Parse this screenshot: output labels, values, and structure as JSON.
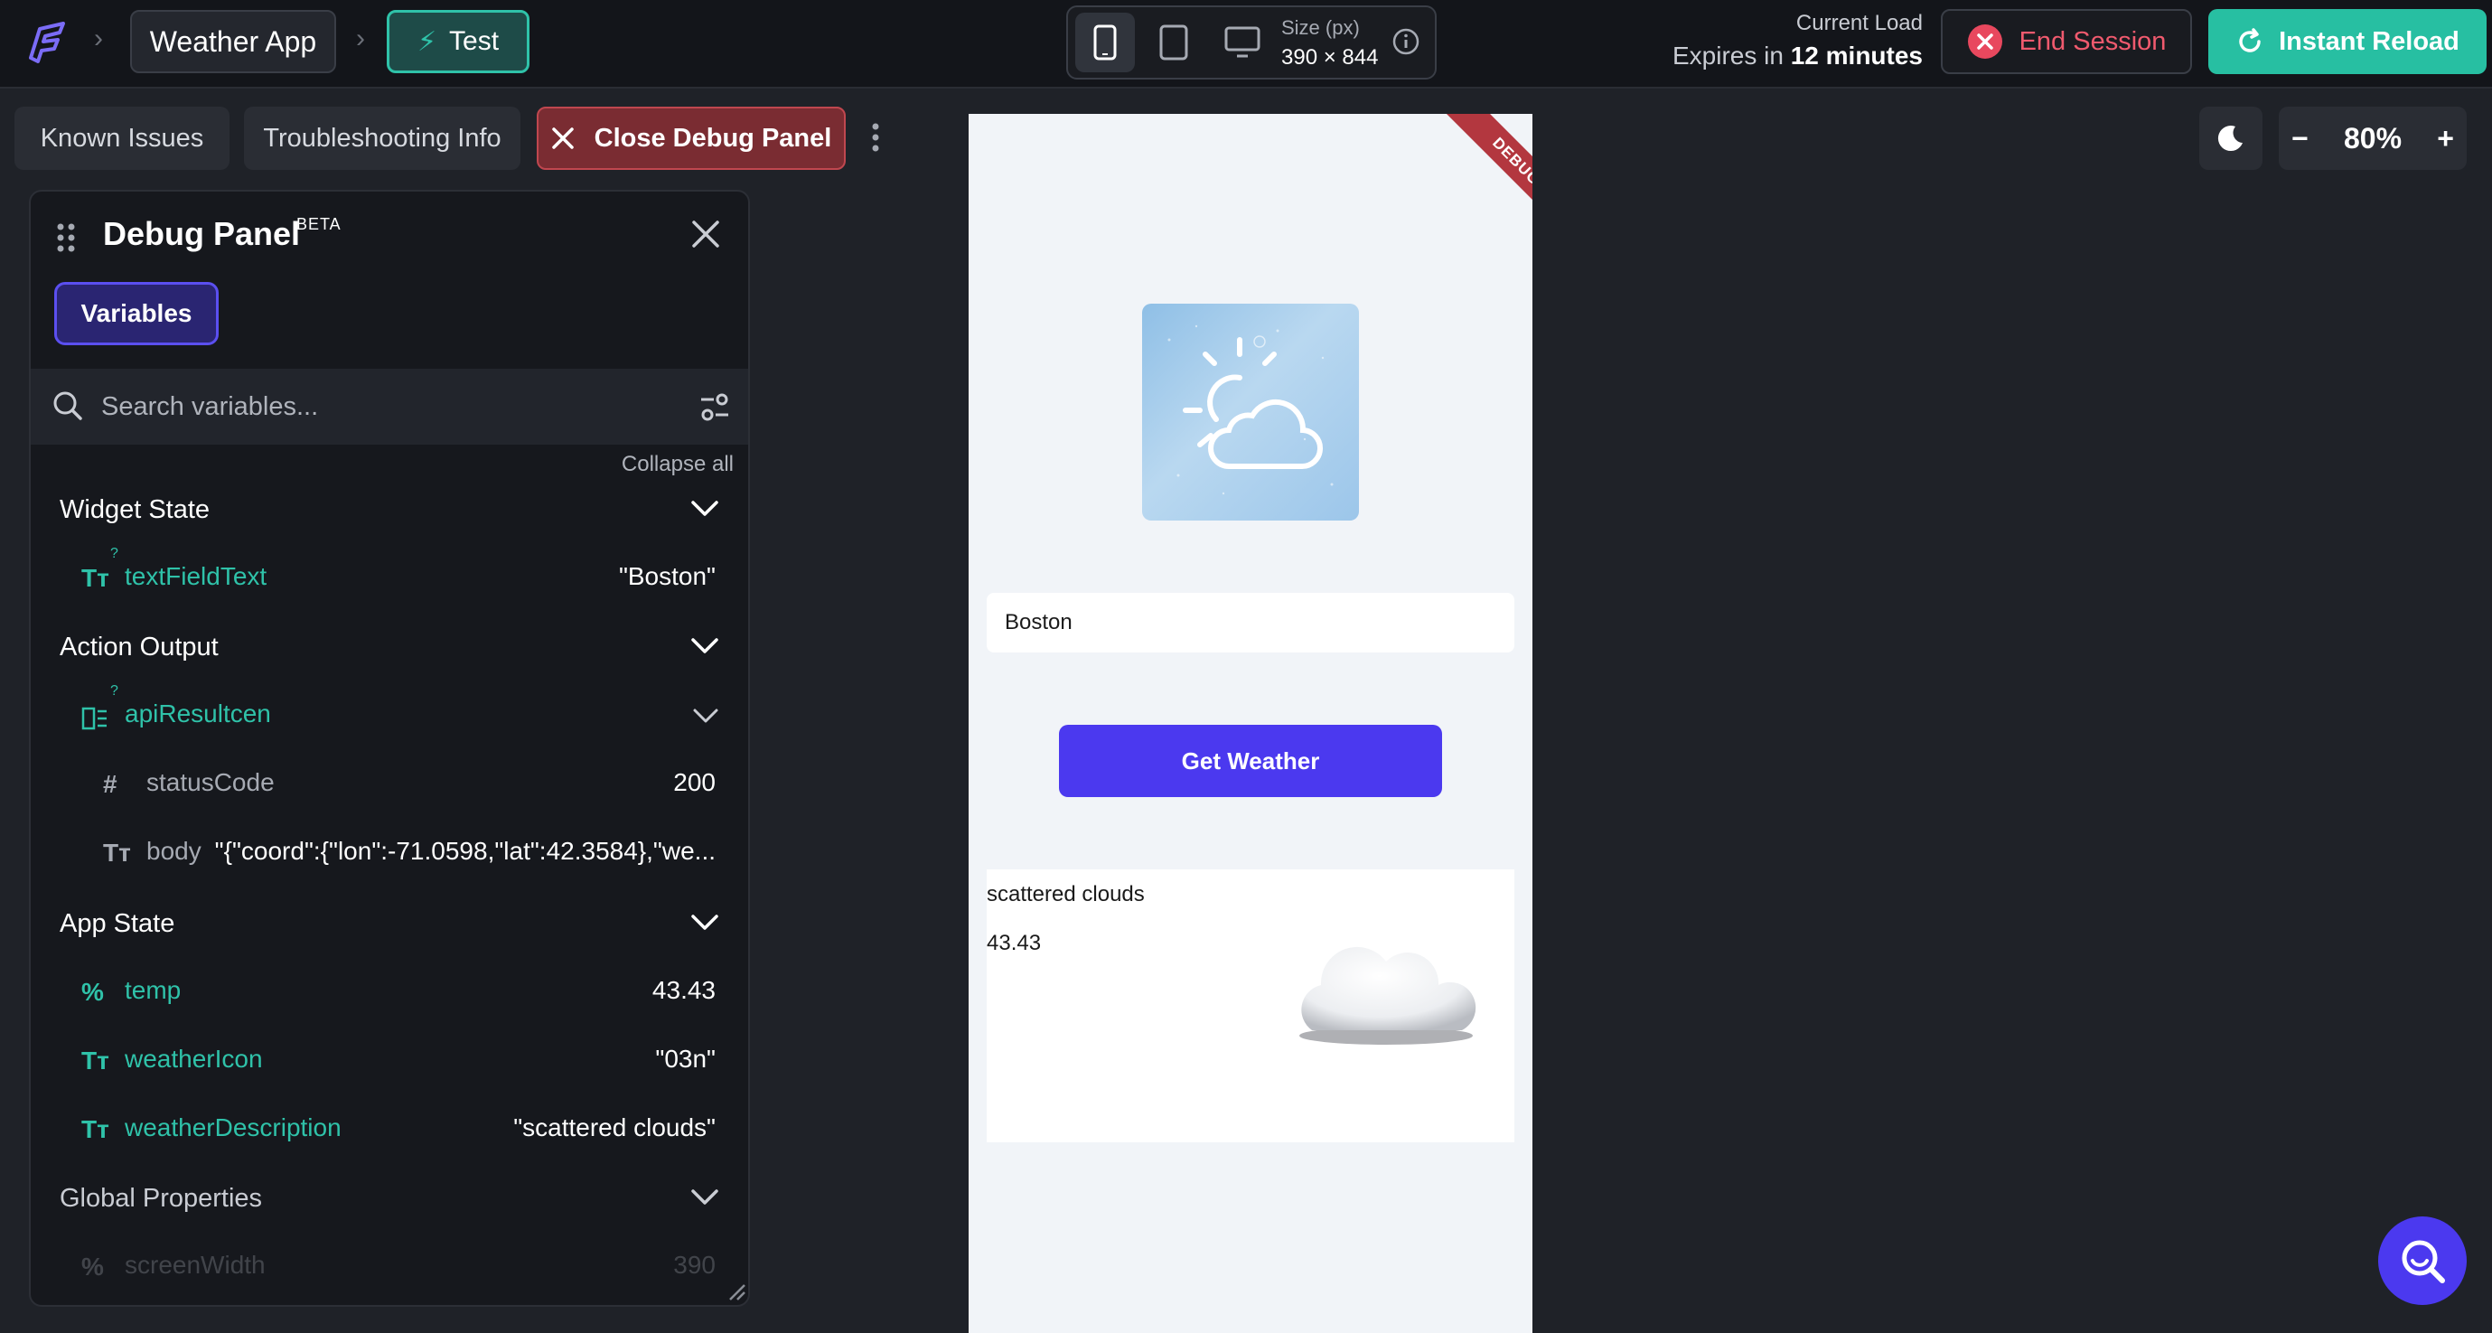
{
  "topbar": {
    "app_name": "Weather App",
    "mode_label": "Test",
    "device_size_label": "Size (px)",
    "device_size_value": "390 × 844",
    "current_load_label": "Current Load",
    "expires_prefix": "Expires in",
    "expires_value": "12 minutes",
    "end_session_label": "End Session",
    "instant_reload_label": "Instant Reload"
  },
  "toolbar": {
    "known_issues_label": "Known Issues",
    "troubleshooting_label": "Troubleshooting Info",
    "close_debug_label": "Close Debug Panel",
    "zoom_minus": "−",
    "zoom_level": "80%",
    "zoom_plus": "+"
  },
  "debug_panel": {
    "title": "Debug Panel",
    "badge": "BETA",
    "tab_variables": "Variables",
    "search_placeholder": "Search variables...",
    "collapse_all": "Collapse all",
    "sections": {
      "widget_state": {
        "label": "Widget State",
        "items": [
          {
            "icon": "Tт",
            "name": "textFieldText",
            "value": "\"Boston\""
          }
        ]
      },
      "action_output": {
        "label": "Action Output",
        "parent": {
          "name": "apiResultcen"
        },
        "items": [
          {
            "icon": "#",
            "name": "statusCode",
            "value": "200"
          },
          {
            "icon": "Tт",
            "name": "body",
            "value": "\"{\"coord\":{\"lon\":-71.0598,\"lat\":42.3584},\"we..."
          }
        ]
      },
      "app_state": {
        "label": "App State",
        "items": [
          {
            "icon": "%",
            "name": "temp",
            "value": "43.43"
          },
          {
            "icon": "Tт",
            "name": "weatherIcon",
            "value": "\"03n\""
          },
          {
            "icon": "Tт",
            "name": "weatherDescription",
            "value": "\"scattered clouds\""
          }
        ]
      },
      "global_properties": {
        "label": "Global Properties",
        "items": [
          {
            "icon": "%",
            "name": "screenWidth",
            "value": "390"
          }
        ]
      }
    }
  },
  "preview": {
    "debug_ribbon": "DEBUG",
    "city_input_value": "Boston",
    "get_weather_label": "Get Weather",
    "description": "scattered clouds",
    "temperature": "43.43"
  },
  "colors": {
    "accent_teal": "#2fc2a9",
    "accent_purple": "#4b39ef",
    "danger": "#f05a6e"
  }
}
